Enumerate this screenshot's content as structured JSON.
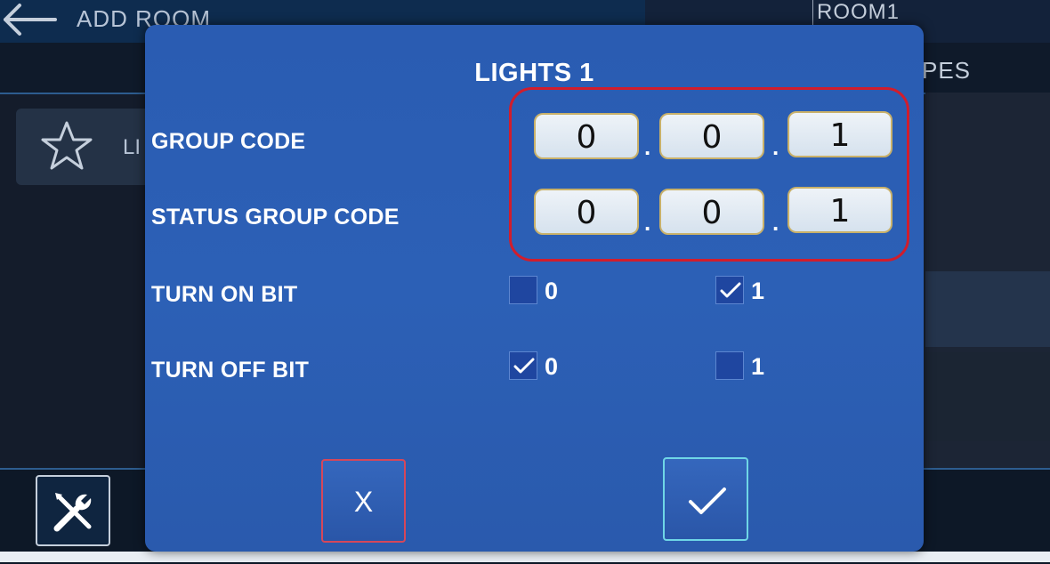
{
  "app": {
    "title": "ADD ROOM",
    "room_name": "ROOM1",
    "tab_types": "PES",
    "sidebar_item_label": "LI"
  },
  "dialog": {
    "title": "LIGHTS 1",
    "group_code": {
      "label": "GROUP CODE",
      "values": [
        "0",
        "0",
        "1"
      ]
    },
    "status_group_code": {
      "label": "STATUS GROUP CODE",
      "values": [
        "0",
        "0",
        "1"
      ]
    },
    "separator": ".",
    "turn_on_bit": {
      "label": "TURN ON BIT",
      "options": [
        {
          "label": "0",
          "checked": false
        },
        {
          "label": "1",
          "checked": true
        }
      ]
    },
    "turn_off_bit": {
      "label": "TURN OFF BIT",
      "options": [
        {
          "label": "0",
          "checked": true
        },
        {
          "label": "1",
          "checked": false
        }
      ]
    },
    "cancel_label": "X",
    "confirm_icon": "check-icon"
  },
  "colors": {
    "dialog_bg": "#2c60b6",
    "highlight": "#d11d2c",
    "cancel_border": "#d6475a",
    "confirm_border": "#6fd6e6"
  }
}
